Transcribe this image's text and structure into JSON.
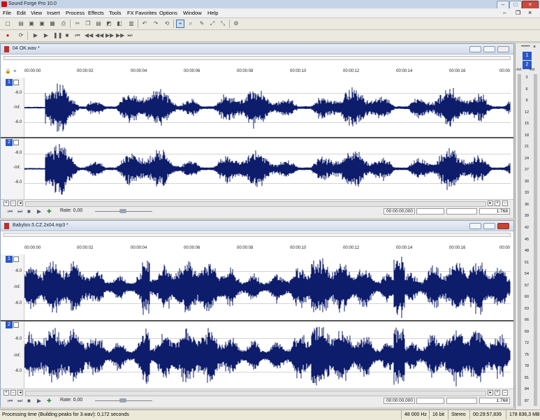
{
  "app": {
    "title": "Sound Forge Pro 10.0"
  },
  "menu": [
    "File",
    "Edit",
    "View",
    "Insert",
    "Process",
    "Effects",
    "Tools",
    "FX Favorites",
    "Options",
    "Window",
    "Help"
  ],
  "time_ticks": [
    "00:00:00",
    "00:00:02",
    "00:00:04",
    "00:00:06",
    "00:00:08",
    "00:00:10",
    "00:00:12",
    "00:00:14",
    "00:00:16",
    "00:00"
  ],
  "db_labels": {
    "upper": "-6.0",
    "center": "-Inf.",
    "lower": "-6.0"
  },
  "documents": [
    {
      "name": "04 OK.wav *",
      "channels": [
        "1",
        "2"
      ],
      "rate_label": "Rate: 0,00",
      "position": "00:00:00,000",
      "zoom": "1:768"
    },
    {
      "name": "Babylon.5.CZ.2x04.mp3 *",
      "channels": [
        "1",
        "2"
      ],
      "rate_label": "Rate: 0,00",
      "position": "00:00:00,000",
      "zoom": "1:768"
    }
  ],
  "meters": {
    "channels": [
      "1",
      "2"
    ],
    "header_labels": [
      "-Inf.",
      "-Inf."
    ],
    "scale": [
      "3",
      "6",
      "9",
      "12",
      "15",
      "18",
      "21",
      "24",
      "27",
      "30",
      "33",
      "36",
      "39",
      "42",
      "45",
      "48",
      "51",
      "54",
      "57",
      "60",
      "63",
      "66",
      "69",
      "72",
      "75",
      "78",
      "81",
      "84",
      "87"
    ]
  },
  "status": {
    "message": "Processing time (Building peaks for 3.wav): 0,172 seconds",
    "sample_rate": "48 000 Hz",
    "bit_depth": "16 bit",
    "channels": "Stereo",
    "time_left": "00:29:57,839",
    "disk": "178 836,3 MB"
  },
  "colors": {
    "waveform": "#0d1c6b",
    "accent": "#2a57c7",
    "close": "#c84a3d"
  }
}
